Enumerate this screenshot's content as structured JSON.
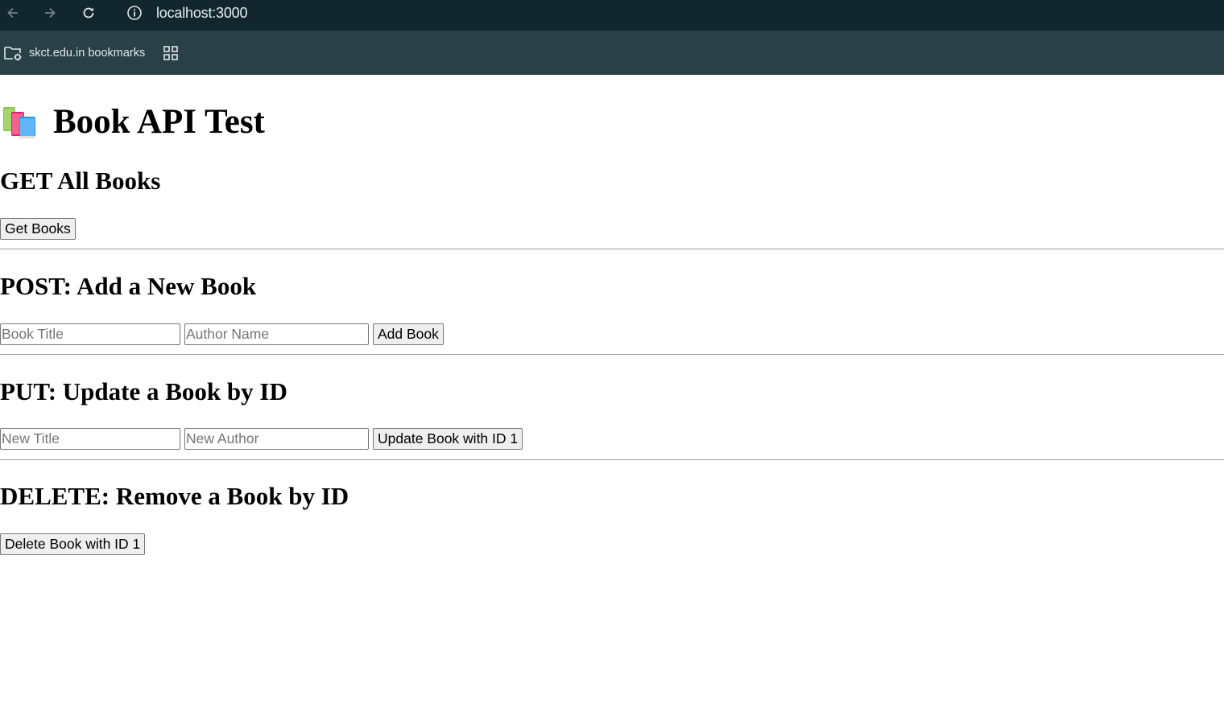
{
  "browser": {
    "url": "localhost:3000",
    "bookmarks": [
      {
        "label": "skct.edu.in bookmarks"
      }
    ]
  },
  "page": {
    "title": "Book API Test",
    "title_emoji": "books-icon",
    "sections": {
      "get": {
        "heading": "GET All Books",
        "button": "Get Books"
      },
      "post": {
        "heading": "POST: Add a New Book",
        "title_placeholder": "Book Title",
        "author_placeholder": "Author Name",
        "button": "Add Book"
      },
      "put": {
        "heading": "PUT: Update a Book by ID",
        "title_placeholder": "New Title",
        "author_placeholder": "New Author",
        "button": "Update Book with ID 1"
      },
      "delete": {
        "heading": "DELETE: Remove a Book by ID",
        "button": "Delete Book with ID 1"
      }
    }
  }
}
